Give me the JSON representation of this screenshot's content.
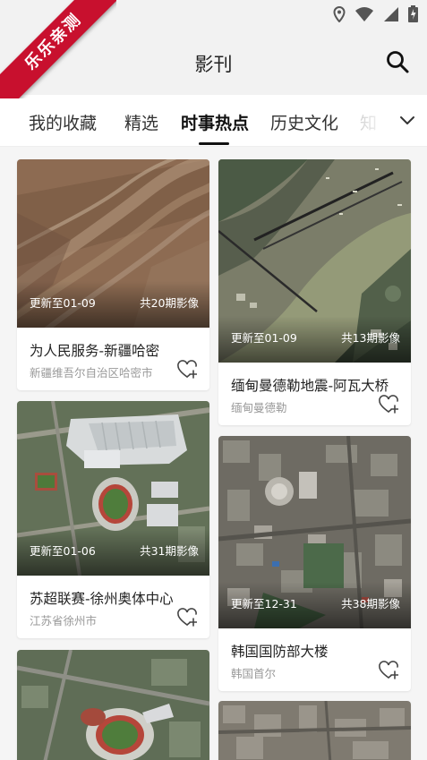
{
  "ribbon": {
    "text": "乐乐亲测"
  },
  "header": {
    "title": "影刊"
  },
  "tabs": [
    {
      "label": "我的收藏"
    },
    {
      "label": "精选"
    },
    {
      "label": "时事热点"
    },
    {
      "label": "历史文化"
    },
    {
      "label": "知"
    }
  ],
  "active_tab": "时事热点",
  "cards": [
    {
      "updated": "更新至01-09",
      "count": "共20期影像",
      "title": "为人民服务-新疆哈密",
      "location": "新疆维吾尔自治区哈密市"
    },
    {
      "updated": "更新至01-09",
      "count": "共13期影像",
      "title": "缅甸曼德勒地震-阿瓦大桥",
      "location": "缅甸曼德勒"
    },
    {
      "updated": "更新至01-06",
      "count": "共31期影像",
      "title": "苏超联赛-徐州奥体中心",
      "location": "江苏省徐州市"
    },
    {
      "updated": "更新至12-31",
      "count": "共38期影像",
      "title": "韩国国防部大楼",
      "location": "韩国首尔"
    }
  ],
  "icons": {
    "back": "back-arrow-icon",
    "search": "search-icon",
    "expand": "chevron-down-icon",
    "favorite": "heart-plus-icon",
    "location": "location-pin-icon",
    "wifi": "wifi-icon",
    "signal": "signal-icon",
    "battery": "battery-charging-icon"
  }
}
